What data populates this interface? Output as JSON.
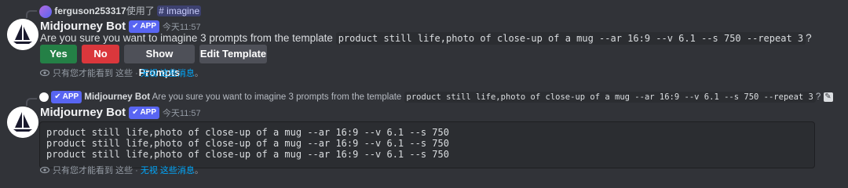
{
  "message1": {
    "reply_user": "ferguson253317",
    "reply_used": "使用了",
    "reply_command": "imagine",
    "author": "Midjourney Bot",
    "badge": "APP",
    "time": "今天11:57",
    "text_prefix": "Are you sure you want to imagine 3 prompts from the template",
    "template_code": "product still life,photo of close-up of a mug --ar 16:9 --v 6.1 --s 750 --repeat 3",
    "text_suffix": "?",
    "buttons": {
      "yes": "Yes",
      "no": "No",
      "show_prompts": "Show Prompts",
      "edit_template": "Edit Template"
    },
    "ephemeral_text": "只有您才能看到 这些 · ",
    "dismiss_link": "无视 这些消息",
    "ephemeral_end": "。"
  },
  "message2": {
    "reply_badge": "APP",
    "reply_author": "Midjourney Bot",
    "reply_text": "Are you sure you want to imagine 3 prompts from the template",
    "reply_code": "product still life,photo of close-up of a mug --ar 16:9 --v 6.1 --s 750 --repeat 3",
    "reply_suffix": "?",
    "author": "Midjourney Bot",
    "badge": "APP",
    "time": "今天11:57",
    "prompts": [
      "product still life,photo of close-up of a mug --ar 16:9 --v 6.1 --s 750",
      "product still life,photo of close-up of a mug --ar 16:9 --v 6.1 --s 750",
      "product still life,photo of close-up of a mug --ar 16:9 --v 6.1 --s 750"
    ],
    "ephemeral_text": "只有您才能看到 这些 · ",
    "dismiss_link": "无视 这些消息",
    "ephemeral_end": "。"
  },
  "colors": {
    "background": "#313338",
    "blurple": "#5865f2",
    "yes_green": "#248046",
    "no_red": "#da373c",
    "secondary": "#4e5058",
    "link": "#00a8fc"
  },
  "icons": {
    "avatar": "midjourney-sailboat-icon",
    "ephemeral": "eye-icon",
    "badge_check": "checkmark-icon",
    "edit": "pencil-icon"
  }
}
